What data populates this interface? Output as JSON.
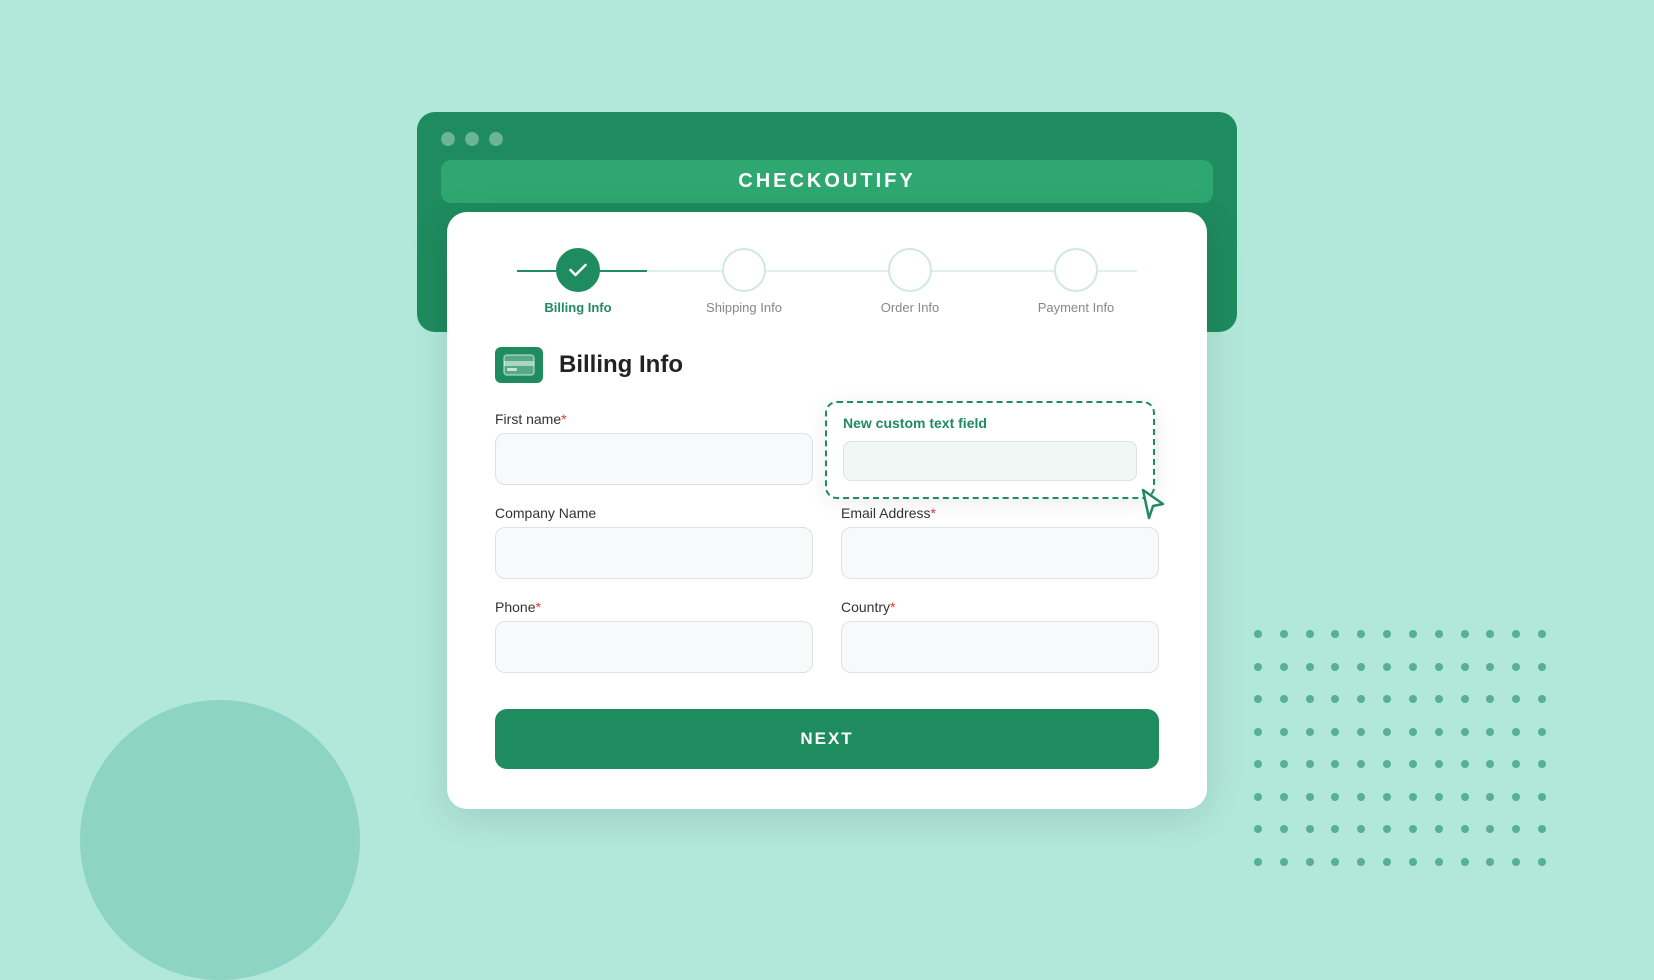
{
  "app": {
    "title": "CHECKOUTIFY"
  },
  "stepper": {
    "steps": [
      {
        "id": "billing",
        "label": "Billing Info",
        "active": true,
        "completed": true
      },
      {
        "id": "shipping",
        "label": "Shipping Info",
        "active": false,
        "completed": false
      },
      {
        "id": "order",
        "label": "Order Info",
        "active": false,
        "completed": false
      },
      {
        "id": "payment",
        "label": "Payment Info",
        "active": false,
        "completed": false
      }
    ]
  },
  "form": {
    "title": "Billing Info",
    "fields": [
      {
        "id": "first_name",
        "label": "First name",
        "required": true,
        "placeholder": ""
      },
      {
        "id": "company",
        "label": "Company Name",
        "required": false,
        "placeholder": ""
      },
      {
        "id": "phone",
        "label": "Phone",
        "required": true,
        "placeholder": ""
      },
      {
        "id": "email",
        "label": "Email Address",
        "required": true,
        "placeholder": ""
      },
      {
        "id": "country",
        "label": "Country",
        "required": true,
        "placeholder": ""
      }
    ],
    "custom_field_label": "New custom text field",
    "next_button": "NEXT"
  },
  "colors": {
    "primary": "#1e8c5e",
    "primary_light": "#2ea870",
    "bg": "#b2e8da",
    "required": "#e53935"
  }
}
